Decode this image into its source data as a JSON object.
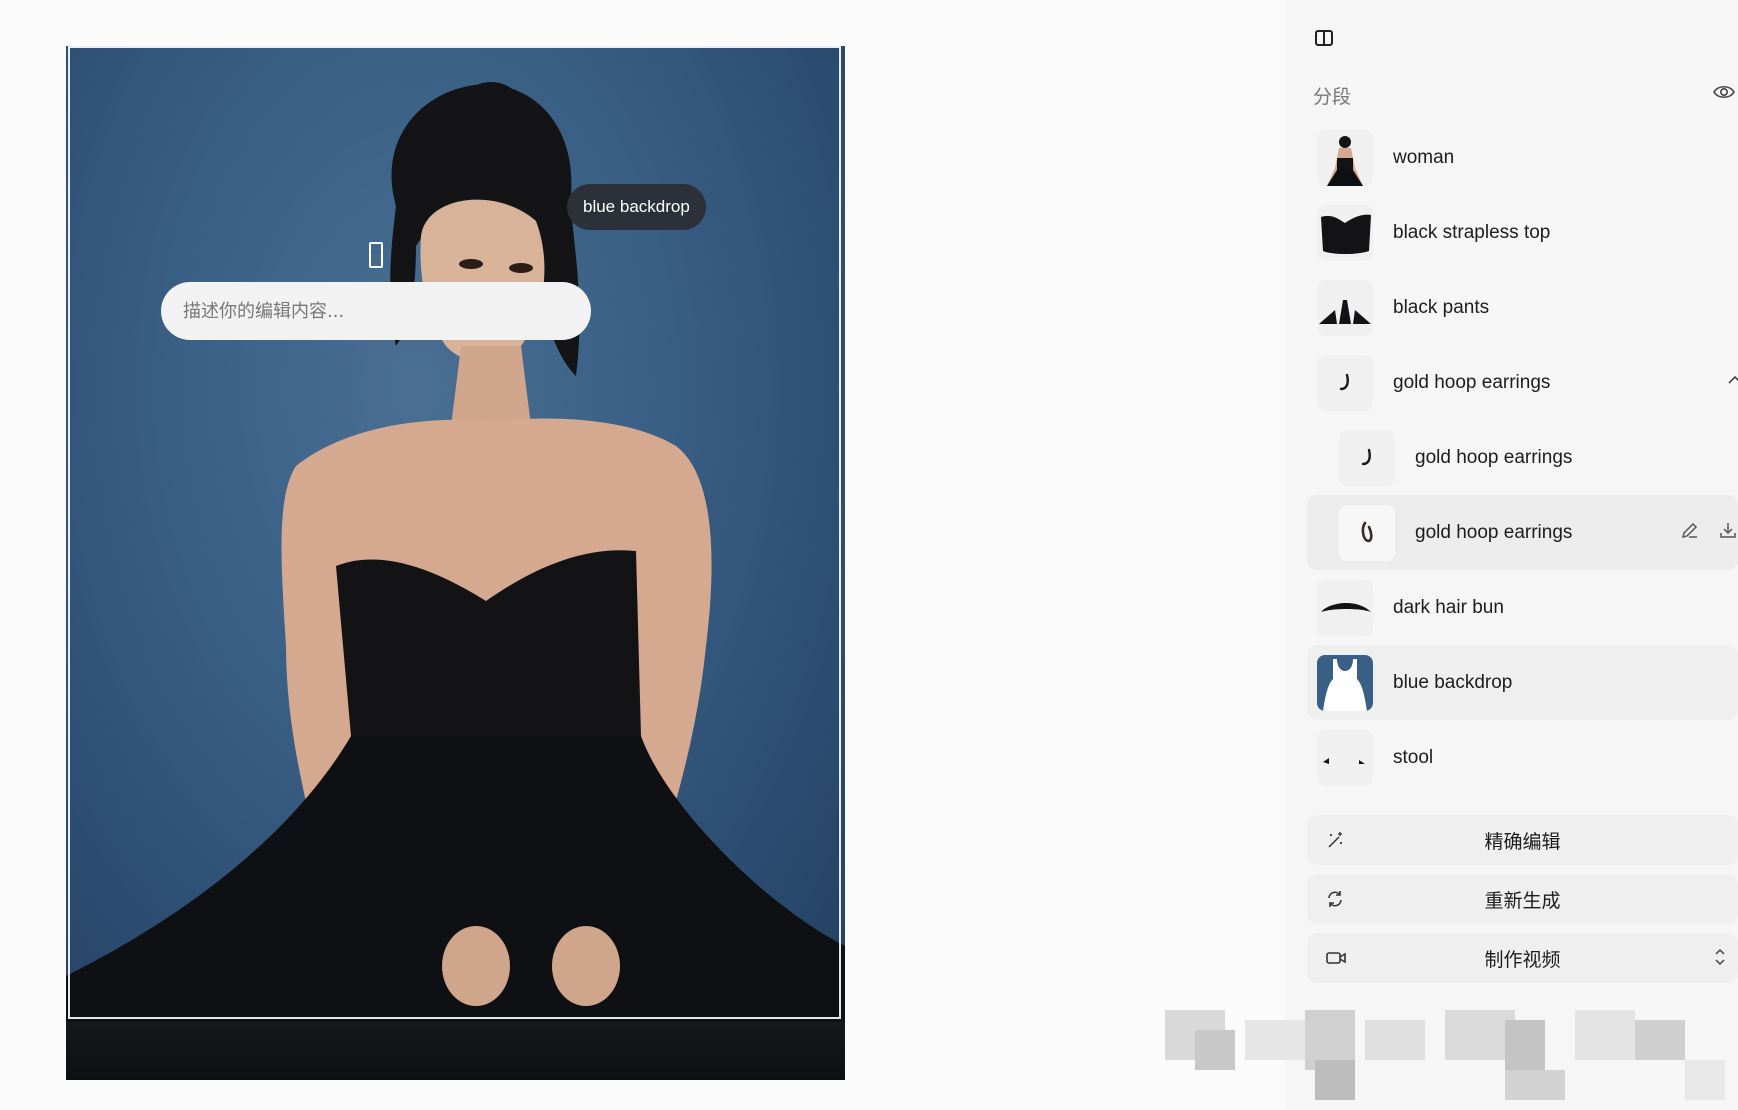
{
  "canvas": {
    "hover_tag": "blue backdrop",
    "prompt_placeholder": "描述你的编辑内容..."
  },
  "panel": {
    "section_title": "分段",
    "toggle_icon": "sidebar-toggle-icon",
    "visibility_icon": "eye-icon",
    "segments": [
      {
        "label": "woman",
        "thumb": "woman-thumbnail"
      },
      {
        "label": "black strapless top",
        "thumb": "top-thumbnail"
      },
      {
        "label": "black pants",
        "thumb": "pants-thumbnail"
      },
      {
        "label": "gold hoop earrings",
        "thumb": "earring-thumbnail",
        "expanded": true
      },
      {
        "label": "gold hoop earrings",
        "thumb": "earring-thumbnail",
        "child": true
      },
      {
        "label": "gold hoop earrings",
        "thumb": "earring-thumbnail",
        "child": true,
        "selected": true
      },
      {
        "label": "dark hair bun",
        "thumb": "hair-thumbnail"
      },
      {
        "label": "blue backdrop",
        "thumb": "backdrop-thumbnail",
        "hover": true
      },
      {
        "label": "stool",
        "thumb": "stool-thumbnail"
      }
    ],
    "actions": [
      {
        "label": "精确编辑",
        "icon": "magic-wand-icon"
      },
      {
        "label": "重新生成",
        "icon": "refresh-icon"
      },
      {
        "label": "制作视频",
        "icon": "video-camera-icon"
      }
    ]
  },
  "colors": {
    "backdrop": "#3a5f85",
    "panel_bg": "#f6f6f6",
    "selected_row": "#ececec"
  }
}
